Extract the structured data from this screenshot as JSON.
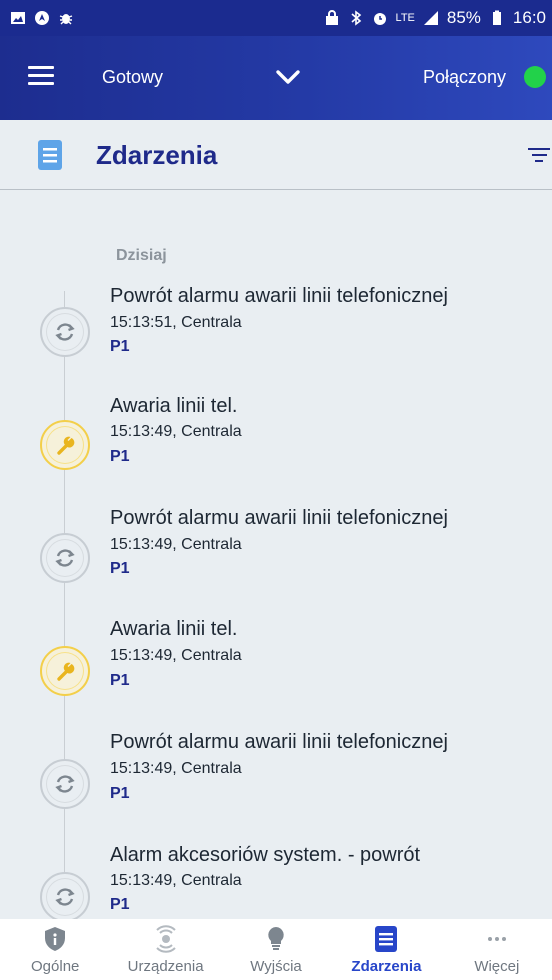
{
  "statusbar": {
    "battery": "85%",
    "time": "16:0",
    "network": "LTE"
  },
  "appbar": {
    "state": "Gotowy",
    "connection": "Połączony",
    "connection_color": "#22d24a"
  },
  "page": {
    "title": "Zdarzenia"
  },
  "events": {
    "day": "Dzisiaj",
    "items": [
      {
        "icon": "sync-icon",
        "title": "Powrót alarmu awarii linii telefonicznej",
        "time": "15:13:51, Centrala",
        "partition": "P1"
      },
      {
        "icon": "wrench-icon",
        "title": "Awaria linii tel.",
        "time": "15:13:49, Centrala",
        "partition": "P1"
      },
      {
        "icon": "sync-icon",
        "title": "Powrót alarmu awarii linii telefonicznej",
        "time": "15:13:49, Centrala",
        "partition": "P1"
      },
      {
        "icon": "wrench-icon",
        "title": "Awaria linii tel.",
        "time": "15:13:49, Centrala",
        "partition": "P1"
      },
      {
        "icon": "sync-icon",
        "title": "Powrót alarmu awarii linii telefonicznej",
        "time": "15:13:49, Centrala",
        "partition": "P1"
      },
      {
        "icon": "sync-icon",
        "title": "Alarm akcesoriów system. - powrót",
        "time": "15:13:49, Centrala",
        "partition": "P1"
      }
    ]
  },
  "nav": {
    "items": [
      {
        "label": "Ogólne",
        "icon": "shield-icon"
      },
      {
        "label": "Urządzenia",
        "icon": "sensor-icon"
      },
      {
        "label": "Wyjścia",
        "icon": "bulb-icon"
      },
      {
        "label": "Zdarzenia",
        "icon": "document-icon",
        "active": true
      },
      {
        "label": "Więcej",
        "icon": "more-icon"
      }
    ]
  },
  "colors": {
    "primary": "#1f2a8a",
    "accent": "#2846c9",
    "warning": "#f3cf4a"
  }
}
